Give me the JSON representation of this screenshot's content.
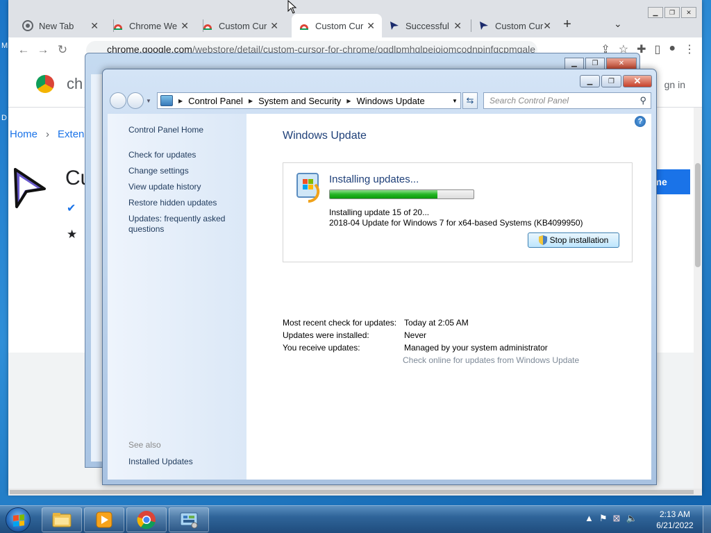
{
  "desktop": {
    "left_text_1": "M",
    "left_text_2": "D"
  },
  "chrome": {
    "tabs": [
      {
        "label": "New Tab",
        "icon": "chrome-icon",
        "close": "✕"
      },
      {
        "label": "Chrome We",
        "icon": "webstore-icon",
        "close": "✕"
      },
      {
        "label": "Custom Cur",
        "icon": "webstore-icon",
        "close": "✕"
      },
      {
        "label": "Custom Cur",
        "icon": "webstore-icon",
        "close": "✕"
      },
      {
        "label": "Successful",
        "icon": "cursor-icon",
        "close": "✕"
      },
      {
        "label": "Custom Cur",
        "icon": "cursor-icon",
        "close": "✕"
      }
    ],
    "new_tab": "+",
    "tab_search": "⌄",
    "window_buttons": [
      "▁",
      "❐",
      "✕"
    ],
    "url_host": "chrome.google.com",
    "url_path": "/webstore/detail/custom-cursor-for-chrome/ogdlpmhglpejoiomcodnpjnfgcpmgale",
    "store": {
      "title": "ch",
      "sign_in": "gn in",
      "breadcrumb_home": "Home",
      "breadcrumb_sep": "›",
      "breadcrumb_ext": "Exten",
      "ext_title": "Cu",
      "verified_label": "✔",
      "stars": "★",
      "add_button": "ome"
    }
  },
  "back_window": {
    "buttons": [
      "▁",
      "❐",
      "✕"
    ]
  },
  "window": {
    "buttons": [
      "▁",
      "❐",
      "✕"
    ],
    "breadcrumb": [
      "Control Panel",
      "System and Security",
      "Windows Update"
    ],
    "search_placeholder": "Search Control Panel",
    "sidebar": {
      "home": "Control Panel Home",
      "links": [
        "Check for updates",
        "Change settings",
        "View update history",
        "Restore hidden updates",
        "Updates: frequently asked questions"
      ],
      "see_also": "See also",
      "installed_updates": "Installed Updates"
    },
    "title": "Windows Update",
    "status": {
      "heading": "Installing updates...",
      "progress": 0.75,
      "line1": "Installing update 15 of 20...",
      "line2": "2018-04 Update for Windows 7 for x64-based Systems (KB4099950)",
      "stop_button": "Stop installation"
    },
    "info": [
      {
        "key": "Most recent check for updates:",
        "value": "Today at 2:05 AM"
      },
      {
        "key": "Updates were installed:",
        "value": "Never"
      },
      {
        "key": "You receive updates:",
        "value": "Managed by your system administrator"
      }
    ],
    "online_link": "Check online for updates from Windows Update"
  },
  "taskbar": {
    "items": [
      "explorer-icon",
      "media-player-icon",
      "chrome-icon",
      "control-panel-icon"
    ],
    "time": "2:13 AM",
    "date": "6/21/2022"
  },
  "colors": {
    "accent": "#1a73e8",
    "progress": "#25b525",
    "title_blue": "#1e3f78"
  }
}
